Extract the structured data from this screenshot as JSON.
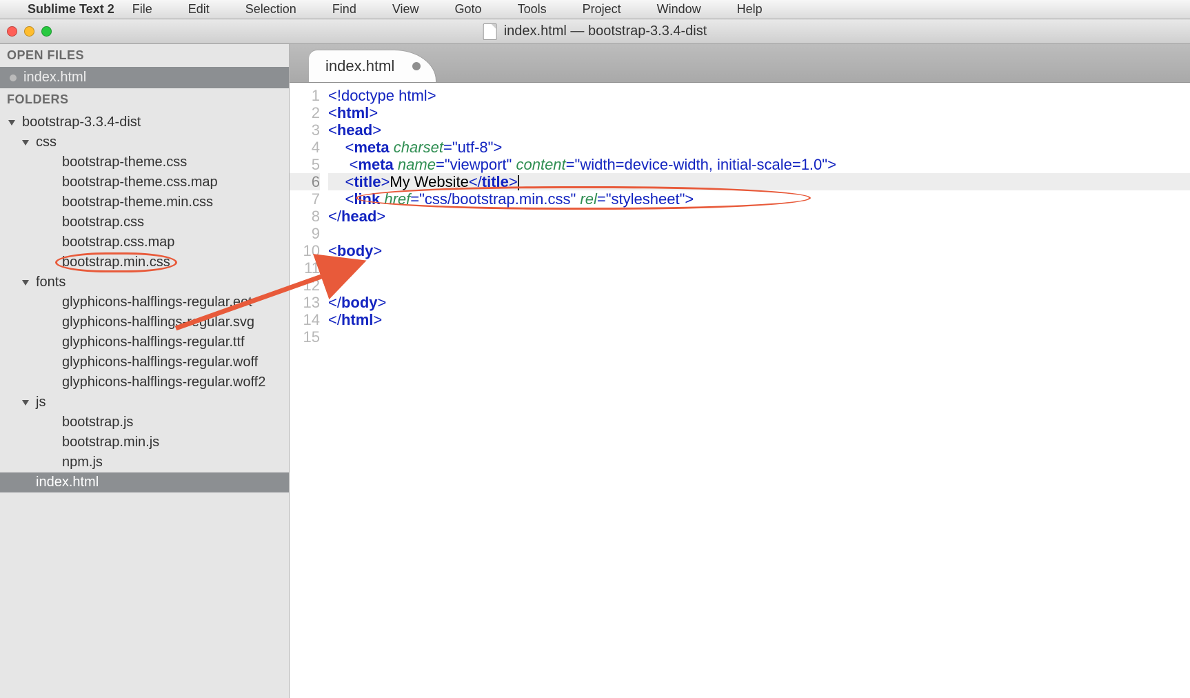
{
  "menubar": {
    "app_name": "Sublime Text 2",
    "items": [
      "File",
      "Edit",
      "Selection",
      "Find",
      "View",
      "Goto",
      "Tools",
      "Project",
      "Window",
      "Help"
    ]
  },
  "window": {
    "title": "index.html — bootstrap-3.3.4-dist"
  },
  "sidebar": {
    "open_files_label": "OPEN FILES",
    "open_files": [
      {
        "name": "index.html",
        "dirty": true
      }
    ],
    "folders_label": "FOLDERS",
    "tree": [
      {
        "depth": 0,
        "kind": "dir",
        "name": "bootstrap-3.3.4-dist",
        "open": true
      },
      {
        "depth": 1,
        "kind": "dir",
        "name": "css",
        "open": true
      },
      {
        "depth": 2,
        "kind": "file",
        "name": "bootstrap-theme.css"
      },
      {
        "depth": 2,
        "kind": "file",
        "name": "bootstrap-theme.css.map"
      },
      {
        "depth": 2,
        "kind": "file",
        "name": "bootstrap-theme.min.css"
      },
      {
        "depth": 2,
        "kind": "file",
        "name": "bootstrap.css"
      },
      {
        "depth": 2,
        "kind": "file",
        "name": "bootstrap.css.map"
      },
      {
        "depth": 2,
        "kind": "file",
        "name": "bootstrap.min.css",
        "circled": true
      },
      {
        "depth": 1,
        "kind": "dir",
        "name": "fonts",
        "open": true
      },
      {
        "depth": 2,
        "kind": "file",
        "name": "glyphicons-halflings-regular.eot"
      },
      {
        "depth": 2,
        "kind": "file",
        "name": "glyphicons-halflings-regular.svg"
      },
      {
        "depth": 2,
        "kind": "file",
        "name": "glyphicons-halflings-regular.ttf"
      },
      {
        "depth": 2,
        "kind": "file",
        "name": "glyphicons-halflings-regular.woff"
      },
      {
        "depth": 2,
        "kind": "file",
        "name": "glyphicons-halflings-regular.woff2"
      },
      {
        "depth": 1,
        "kind": "dir",
        "name": "js",
        "open": true
      },
      {
        "depth": 2,
        "kind": "file",
        "name": "bootstrap.js"
      },
      {
        "depth": 2,
        "kind": "file",
        "name": "bootstrap.min.js"
      },
      {
        "depth": 2,
        "kind": "file",
        "name": "npm.js"
      },
      {
        "depth": 1,
        "kind": "file",
        "name": "index.html",
        "selected": true
      }
    ]
  },
  "editor": {
    "tab_label": "index.html",
    "tab_dirty": true,
    "current_line": 6,
    "line_count": 15,
    "code": [
      {
        "n": 1,
        "tokens": [
          [
            "doctype",
            "<!doctype html>"
          ]
        ]
      },
      {
        "n": 2,
        "tokens": [
          [
            "punct",
            "<"
          ],
          [
            "tag",
            "html"
          ],
          [
            "punct",
            ">"
          ]
        ]
      },
      {
        "n": 3,
        "tokens": [
          [
            "punct",
            "<"
          ],
          [
            "tag",
            "head"
          ],
          [
            "punct",
            ">"
          ]
        ]
      },
      {
        "n": 4,
        "indent": 1,
        "tokens": [
          [
            "punct",
            "<"
          ],
          [
            "tag",
            "meta"
          ],
          [
            "txt",
            " "
          ],
          [
            "attr",
            "charset"
          ],
          [
            "punct",
            "="
          ],
          [
            "str",
            "\"utf-8\""
          ],
          [
            "punct",
            ">"
          ]
        ]
      },
      {
        "n": 5,
        "indent": 1,
        "extra": " ",
        "tokens": [
          [
            "punct",
            "<"
          ],
          [
            "tag",
            "meta"
          ],
          [
            "txt",
            " "
          ],
          [
            "attr",
            "name"
          ],
          [
            "punct",
            "="
          ],
          [
            "str",
            "\"viewport\""
          ],
          [
            "txt",
            " "
          ],
          [
            "attr",
            "content"
          ],
          [
            "punct",
            "="
          ],
          [
            "str",
            "\"width=device-width, initial-scale=1.0\""
          ],
          [
            "punct",
            ">"
          ]
        ]
      },
      {
        "n": 6,
        "indent": 1,
        "tokens": [
          [
            "punct",
            "<"
          ],
          [
            "tag",
            "title"
          ],
          [
            "punct",
            ">"
          ],
          [
            "txt",
            "My Website"
          ],
          [
            "punct",
            "</"
          ],
          [
            "tag",
            "title"
          ],
          [
            "punct",
            ">"
          ]
        ],
        "caret_after": true
      },
      {
        "n": 7,
        "indent": 1,
        "tokens": [
          [
            "punct",
            "<"
          ],
          [
            "tag",
            "link"
          ],
          [
            "txt",
            " "
          ],
          [
            "attr",
            "href"
          ],
          [
            "punct",
            "="
          ],
          [
            "str",
            "\"css/bootstrap.min.css\""
          ],
          [
            "txt",
            " "
          ],
          [
            "attr",
            "rel"
          ],
          [
            "punct",
            "="
          ],
          [
            "str",
            "\"stylesheet\""
          ],
          [
            "punct",
            ">"
          ]
        ],
        "circled": true
      },
      {
        "n": 8,
        "tokens": [
          [
            "punct",
            "</"
          ],
          [
            "tag",
            "head"
          ],
          [
            "punct",
            ">"
          ]
        ]
      },
      {
        "n": 9,
        "tokens": []
      },
      {
        "n": 10,
        "tokens": [
          [
            "punct",
            "<"
          ],
          [
            "tag",
            "body"
          ],
          [
            "punct",
            ">"
          ]
        ]
      },
      {
        "n": 11,
        "tokens": []
      },
      {
        "n": 12,
        "tokens": []
      },
      {
        "n": 13,
        "tokens": [
          [
            "punct",
            "</"
          ],
          [
            "tag",
            "body"
          ],
          [
            "punct",
            ">"
          ]
        ]
      },
      {
        "n": 14,
        "tokens": [
          [
            "punct",
            "</"
          ],
          [
            "tag",
            "html"
          ],
          [
            "punct",
            ">"
          ]
        ]
      },
      {
        "n": 15,
        "tokens": []
      }
    ]
  },
  "annotation": {
    "arrow_color": "#e85a3a"
  }
}
